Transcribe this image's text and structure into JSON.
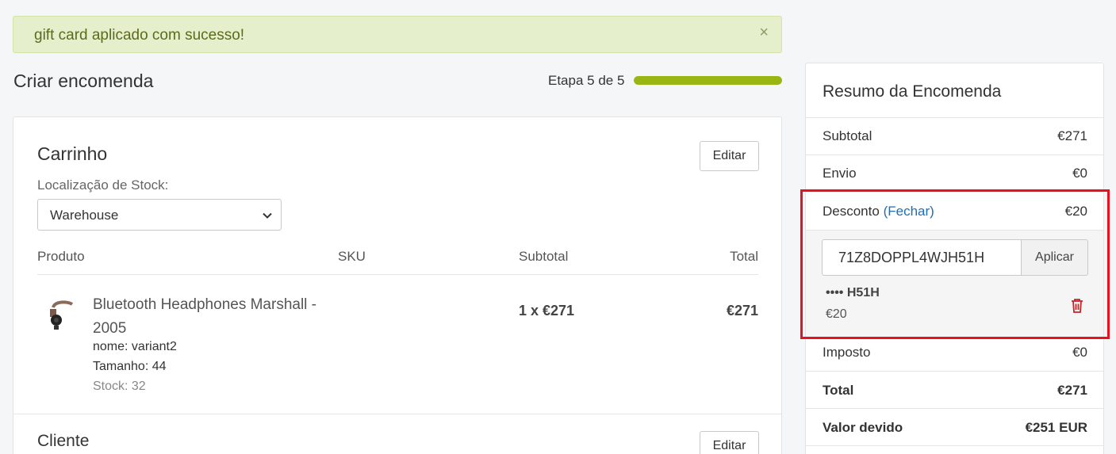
{
  "alert": {
    "message": "gift card aplicado com sucesso!",
    "close": "×"
  },
  "header": {
    "title": "Criar encomenda",
    "step_label": "Etapa 5 de 5",
    "step_progress": 1.0
  },
  "cart": {
    "title": "Carrinho",
    "edit_label": "Editar",
    "stock_location_label": "Localização de Stock:",
    "stock_location_value": "Warehouse",
    "columns": {
      "product": "Produto",
      "sku": "SKU",
      "subtotal": "Subtotal",
      "total": "Total"
    },
    "item": {
      "name": "Bluetooth Headphones Marshall - 2005",
      "variant_name": "nome: variant2",
      "size": "Tamanho: 44",
      "stock": "Stock: 32",
      "subtotal": "1 x €271",
      "total": "€271"
    }
  },
  "client": {
    "title": "Cliente",
    "edit_label": "Editar"
  },
  "summary": {
    "title": "Resumo da Encomenda",
    "subtotal_label": "Subtotal",
    "subtotal_value": "€271",
    "shipping_label": "Envio",
    "shipping_value": "€0",
    "discount_label": "Desconto",
    "discount_toggle": "(Fechar)",
    "discount_value": "€20",
    "code_value": "71Z8DOPPL4WJH51H",
    "apply_label": "Aplicar",
    "applied_card_mask": "•••• H51H",
    "applied_card_amount": "€20",
    "tax_label": "Imposto",
    "tax_value": "€0",
    "total_label": "Total",
    "total_value": "€271",
    "due_label": "Valor devido",
    "due_value": "€251 EUR"
  },
  "colors": {
    "accent_green": "#98b514",
    "alert_bg": "#e6efcb",
    "link": "#1b6fb5",
    "highlight": "#e8121f",
    "trash": "#c0262d"
  }
}
